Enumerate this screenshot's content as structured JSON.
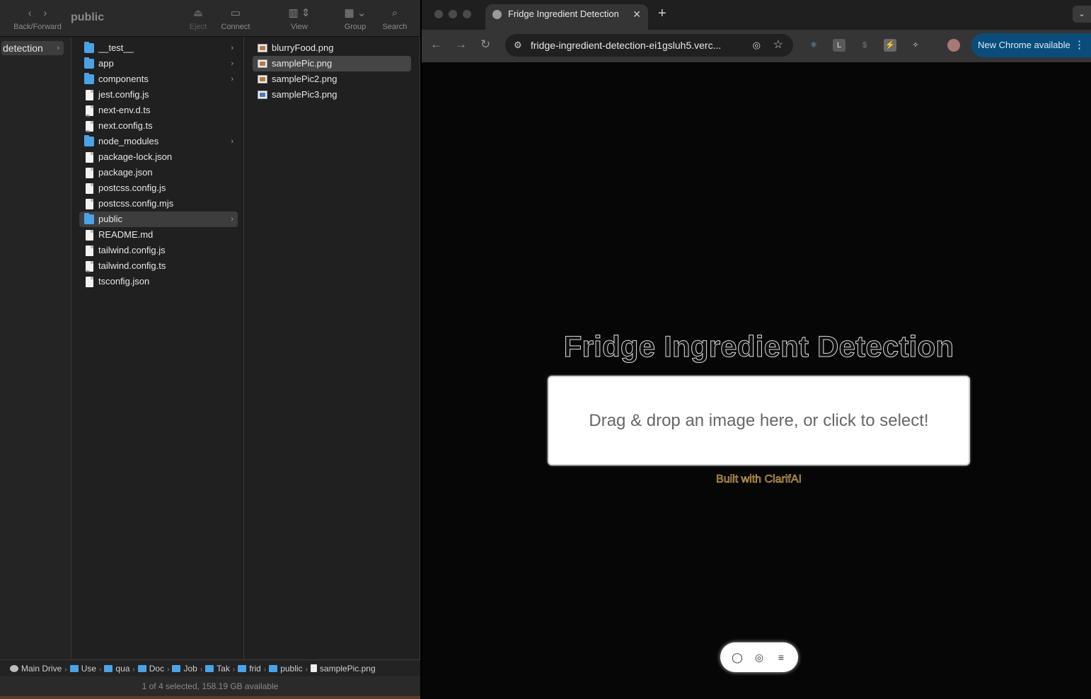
{
  "finder": {
    "toolbar": {
      "back_forward_label": "Back/Forward",
      "title": "public",
      "eject_label": "Eject",
      "connect_label": "Connect",
      "view_label": "View",
      "group_label": "Group",
      "search_label": "Search"
    },
    "column1": {
      "selected_item": "detection"
    },
    "column2": {
      "items": [
        {
          "name": "__test__",
          "kind": "folder"
        },
        {
          "name": "app",
          "kind": "folder"
        },
        {
          "name": "components",
          "kind": "folder"
        },
        {
          "name": "jest.config.js",
          "kind": "file"
        },
        {
          "name": "next-env.d.ts",
          "kind": "ts-file"
        },
        {
          "name": "next.config.ts",
          "kind": "ts-file"
        },
        {
          "name": "node_modules",
          "kind": "folder"
        },
        {
          "name": "package-lock.json",
          "kind": "file"
        },
        {
          "name": "package.json",
          "kind": "file"
        },
        {
          "name": "postcss.config.js",
          "kind": "file"
        },
        {
          "name": "postcss.config.mjs",
          "kind": "file"
        },
        {
          "name": "public",
          "kind": "folder",
          "selected": true
        },
        {
          "name": "README.md",
          "kind": "file"
        },
        {
          "name": "tailwind.config.js",
          "kind": "file"
        },
        {
          "name": "tailwind.config.ts",
          "kind": "ts-file"
        },
        {
          "name": "tsconfig.json",
          "kind": "file"
        }
      ]
    },
    "column3": {
      "items": [
        {
          "name": "blurryFood.png",
          "kind": "image"
        },
        {
          "name": "samplePic.png",
          "kind": "image",
          "selected": true
        },
        {
          "name": "samplePic2.png",
          "kind": "image"
        },
        {
          "name": "samplePic3.png",
          "kind": "image-blue"
        }
      ]
    },
    "path_bar": [
      "Main Drive",
      "Use",
      "qua",
      "Doc",
      "Job",
      "Tak",
      "frid",
      "public",
      "samplePic.png"
    ],
    "status": "1 of 4 selected, 158.19 GB available"
  },
  "chrome": {
    "tab_title": "Fridge Ingredient Detection",
    "url": "fridge-ingredient-detection-ei1gsluh5.verc...",
    "update_button": "New Chrome available",
    "extensions": [
      "react-icon",
      "L",
      "price-icon",
      "stripe-icon",
      "puzzle-icon"
    ],
    "page": {
      "title": "Fridge Ingredient Detection",
      "dropzone_text": "Drag & drop an image here, or click to select!",
      "credit": "Built with ClarifAI"
    }
  },
  "colors": {
    "finder_bg": "#202020",
    "folder_blue": "#4aa3e6",
    "chrome_update": "#0b4d7a",
    "credit_gold": "#f0c070"
  }
}
